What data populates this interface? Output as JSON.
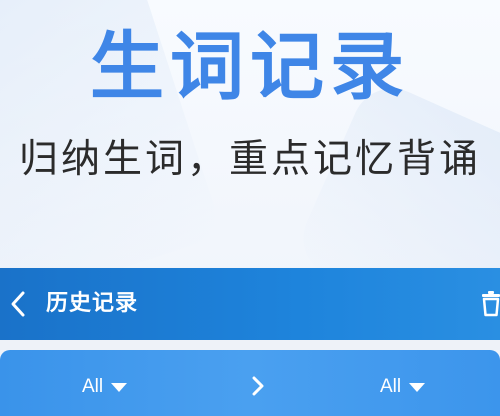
{
  "promo": {
    "headline": "生词记录",
    "subtitle": "归纳生词，重点记忆背诵"
  },
  "nav": {
    "title": "历史记录",
    "back_icon": "chevron-left-icon",
    "action_icon": "trash-icon"
  },
  "filter": {
    "from_label": "All",
    "to_label": "All",
    "separator_icon": "chevron-right-icon"
  },
  "colors": {
    "headline": "#3f86e7",
    "nav_bar": "#1e84dc",
    "filter_bar": "#4aa0f0",
    "text_dark": "#2b2b2b"
  }
}
